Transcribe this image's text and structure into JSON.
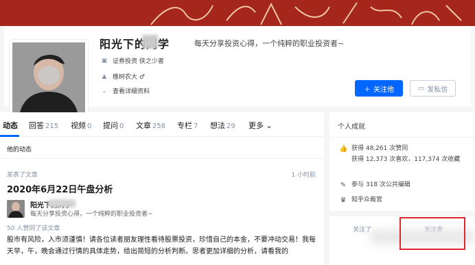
{
  "banner": {
    "color": "#a5261a"
  },
  "profile": {
    "name": "阳光下的同学",
    "bio": "每天分享投资心得，一个纯粹的职业投资者~",
    "rows": [
      {
        "icon": "briefcase-icon",
        "text": "证券投资   侠之少者"
      },
      {
        "icon": "graduation-icon",
        "text": "橡树农大   ♂"
      },
      {
        "icon": "chevron-down-icon",
        "text": "查看详细资料"
      }
    ],
    "follow_label": "关注他",
    "message_label": "发私信"
  },
  "tabs": [
    {
      "label": "动态",
      "count": ""
    },
    {
      "label": "回答",
      "count": "215"
    },
    {
      "label": "视频",
      "count": "0"
    },
    {
      "label": "提问",
      "count": "0"
    },
    {
      "label": "文章",
      "count": "258"
    },
    {
      "label": "专栏",
      "count": "7"
    },
    {
      "label": "想法",
      "count": "29"
    },
    {
      "label": "更多",
      "count": ""
    }
  ],
  "feed": {
    "section_title": "他的动态",
    "action": "发表了文章",
    "time": "1 小时前",
    "article_title": "2020年6月22日午盘分析",
    "author_name": "阳光下的同学",
    "author_bio": "每天分享投资心得，一个纯粹的职业投资者~",
    "voters": "50 人赞同了该文章",
    "excerpt": "股市有风险，入市须谨慎！请各位读者朋友理性看待股票投资，珍惜自己的本金，不要冲动交易！我每天早，午，晚会通过行情的具体走势，给出简短的分析判断。思者更加详细的分析，请看我的"
  },
  "sidebar": {
    "title": "个人成就",
    "achievements": [
      {
        "icon": "thumbs-up-icon",
        "text": "获得 48,261 次赞同"
      },
      {
        "icon": "",
        "text": "获得 12,373 次喜欢，117,374 次收藏"
      },
      {
        "icon": "edit-icon",
        "text": "参与 318 次公共编辑"
      },
      {
        "icon": "crown-icon",
        "text": "知乎众裁官"
      }
    ],
    "following_label": "关注了",
    "followers_label": "关注者"
  },
  "colors": {
    "accent": "#0066ff",
    "highlight": "#e0242b"
  }
}
